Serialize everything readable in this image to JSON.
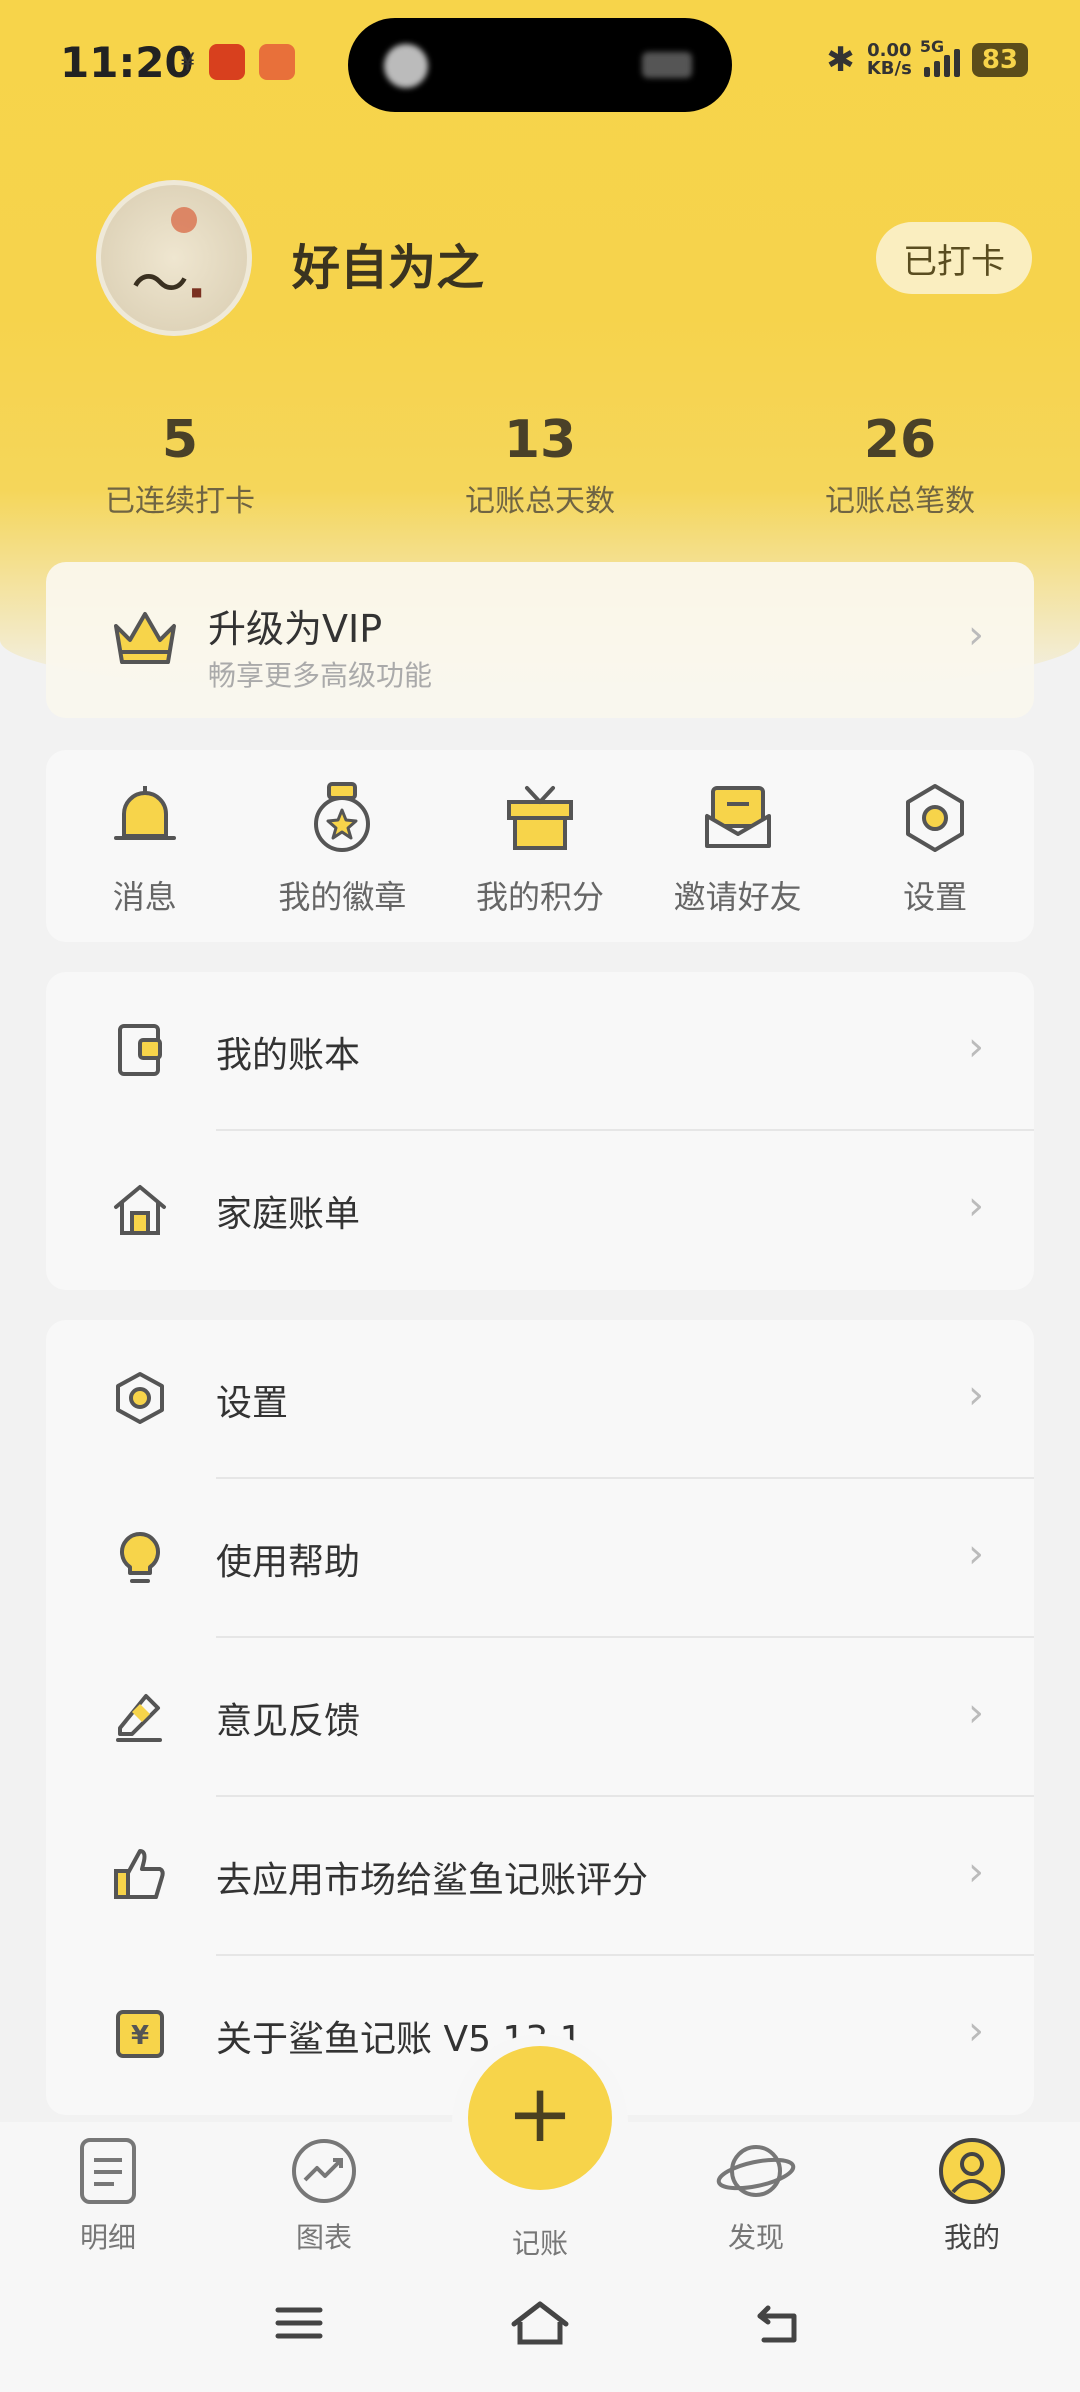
{
  "status_bar": {
    "time": "11:20",
    "yen": "¥",
    "speed_top": "0.00",
    "speed_bottom": "KB/s",
    "network": "5G",
    "battery": "83",
    "bluetooth": "✱"
  },
  "profile": {
    "username": "好自为之",
    "checkin_label": "已打卡"
  },
  "stats": [
    {
      "value": "5",
      "label": "已连续打卡"
    },
    {
      "value": "13",
      "label": "记账总天数"
    },
    {
      "value": "26",
      "label": "记账总笔数"
    }
  ],
  "vip": {
    "title": "升级为VIP",
    "subtitle": "畅享更多高级功能"
  },
  "quick": [
    {
      "label": "消息",
      "icon": "bell-icon"
    },
    {
      "label": "我的徽章",
      "icon": "medal-icon"
    },
    {
      "label": "我的积分",
      "icon": "gift-icon"
    },
    {
      "label": "邀请好友",
      "icon": "envelope-icon"
    },
    {
      "label": "设置",
      "icon": "gear-icon"
    }
  ],
  "list1": [
    {
      "label": "我的账本",
      "icon": "wallet-icon"
    },
    {
      "label": "家庭账单",
      "icon": "home-icon"
    }
  ],
  "list2": [
    {
      "label": "设置",
      "icon": "gear-icon"
    },
    {
      "label": "使用帮助",
      "icon": "lightbulb-icon"
    },
    {
      "label": "意见反馈",
      "icon": "pencil-icon"
    },
    {
      "label": "去应用市场给鲨鱼记账评分",
      "icon": "thumbs-up-icon"
    },
    {
      "label": "关于鲨鱼记账 V5.13.1",
      "icon": "yen-note-icon"
    }
  ],
  "tabs": [
    {
      "label": "明细",
      "icon": "document-icon"
    },
    {
      "label": "图表",
      "icon": "chart-icon"
    },
    {
      "label": "记账",
      "icon": "plus-icon"
    },
    {
      "label": "发现",
      "icon": "planet-icon"
    },
    {
      "label": "我的",
      "icon": "user-icon"
    }
  ],
  "fab": "+",
  "chevron": "›",
  "colors": {
    "accent": "#f7d44a",
    "text": "#333333",
    "muted": "#aaaaaa"
  }
}
